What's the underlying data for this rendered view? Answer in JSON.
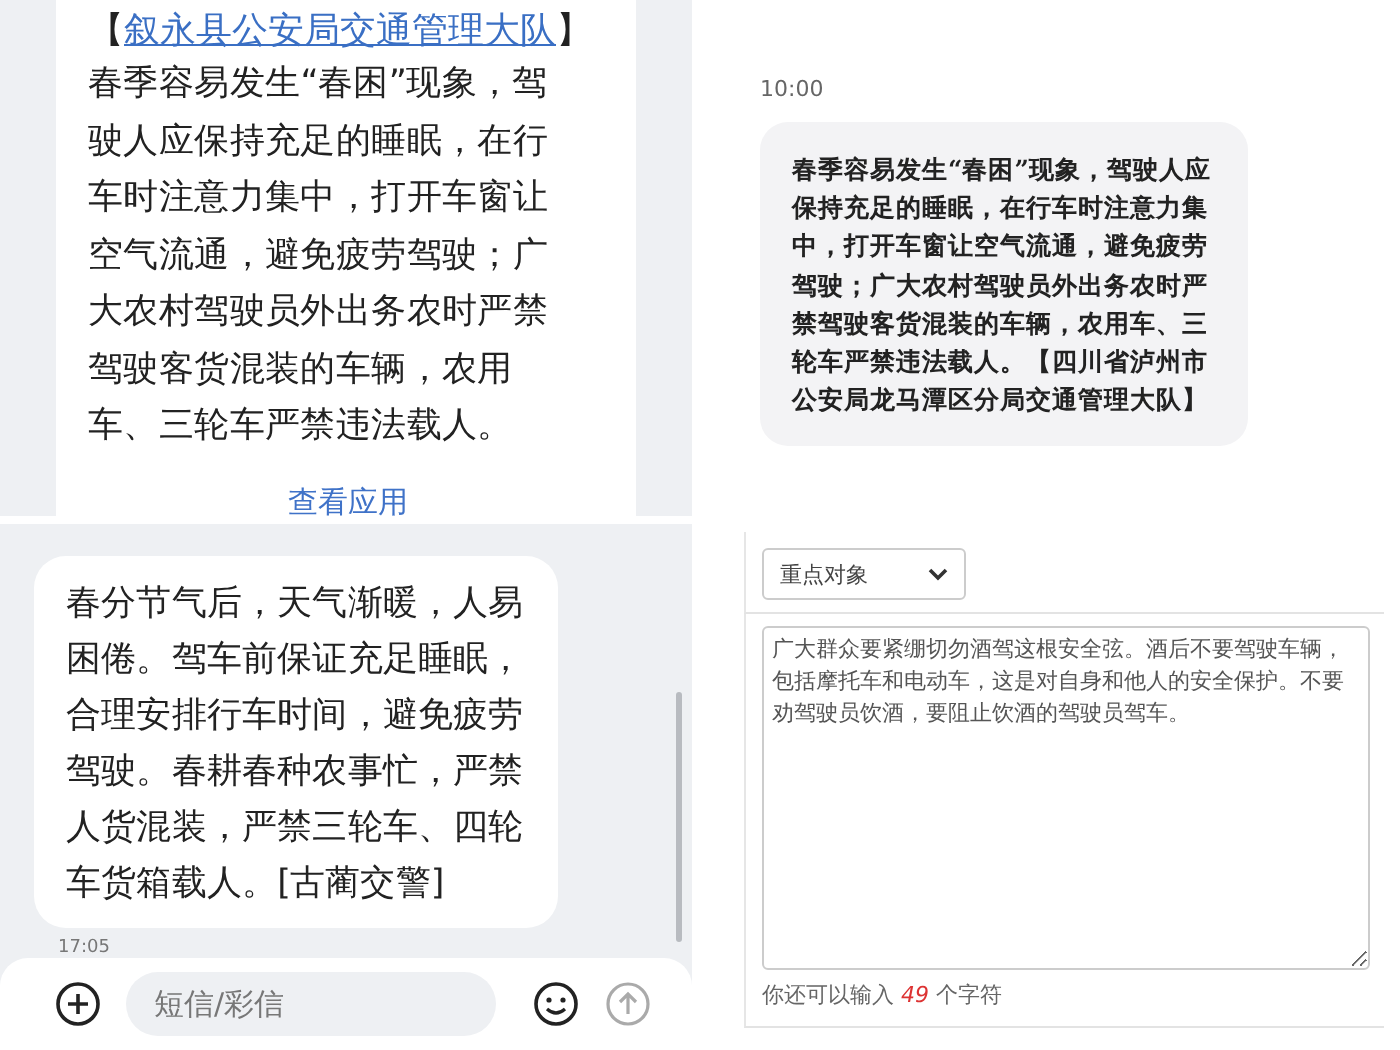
{
  "notification_card": {
    "sender_open": "【",
    "sender": "叙永县公安局交通管理大队",
    "sender_close": "】",
    "body": "春季容易发生“春困”现象，驾驶人应保持充足的睡眠，在行车时注意力集中，打开车窗让空气流通，避免疲劳驾驶；广大农村驾驶员外出务农时严禁驾驶客货混装的车辆，农用车、三轮车严禁违法载人。",
    "action": "查看应用"
  },
  "chat": {
    "time": "10:00",
    "message": "春季容易发生“春困”现象，驾驶人应保持充足的睡眠，在行车时注意力集中，打开车窗让空气流通，避免疲劳驾驶；广大农村驾驶员外出务农时严禁驾驶客货混装的车辆，农用车、三轮车严禁违法载人。【四川省泸州市公安局龙马潭区分局交通管理大队】"
  },
  "sms": {
    "message": "春分节气后，天气渐暖，人易困倦。驾车前保证充足睡眠，合理安排行车时间，避免疲劳驾驶。春耕春种农事忙，严禁人货混装，严禁三轮车、四轮车货箱载人。[古蔺交警]",
    "time": "17:05",
    "input": {
      "placeholder": "短信/彩信"
    }
  },
  "form": {
    "category": {
      "value": "重点对象"
    },
    "content": {
      "value": "广大群众要紧绷切勿酒驾这根安全弦。酒后不要驾驶车辆，包括摩托车和电动车，这是对自身和他人的安全保护。不要劝驾驶员饮酒，要阻止饮酒的驾驶员驾车。"
    },
    "counter_before": "你还可以输入",
    "counter_number": "49",
    "counter_after": "个字符"
  }
}
